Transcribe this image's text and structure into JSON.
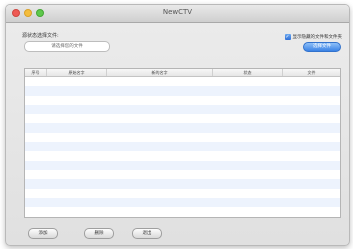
{
  "window": {
    "title": "NewCTV"
  },
  "source": {
    "label": "源状态选择文件:",
    "path_value": "请选择您的文件"
  },
  "options": {
    "checkbox_label": "显示隐藏的文件和文件夹",
    "checkbox_checked": true,
    "primary_button": "选择文件"
  },
  "table": {
    "columns": [
      "序号",
      "原始名字",
      "新的名字",
      "状态",
      "文件"
    ],
    "rows": 15
  },
  "footer": {
    "button_1": "添加",
    "button_2": "删除",
    "button_3": "退出"
  },
  "colors": {
    "accent": "#3a82e5",
    "row_alt": "#edf3fd"
  }
}
